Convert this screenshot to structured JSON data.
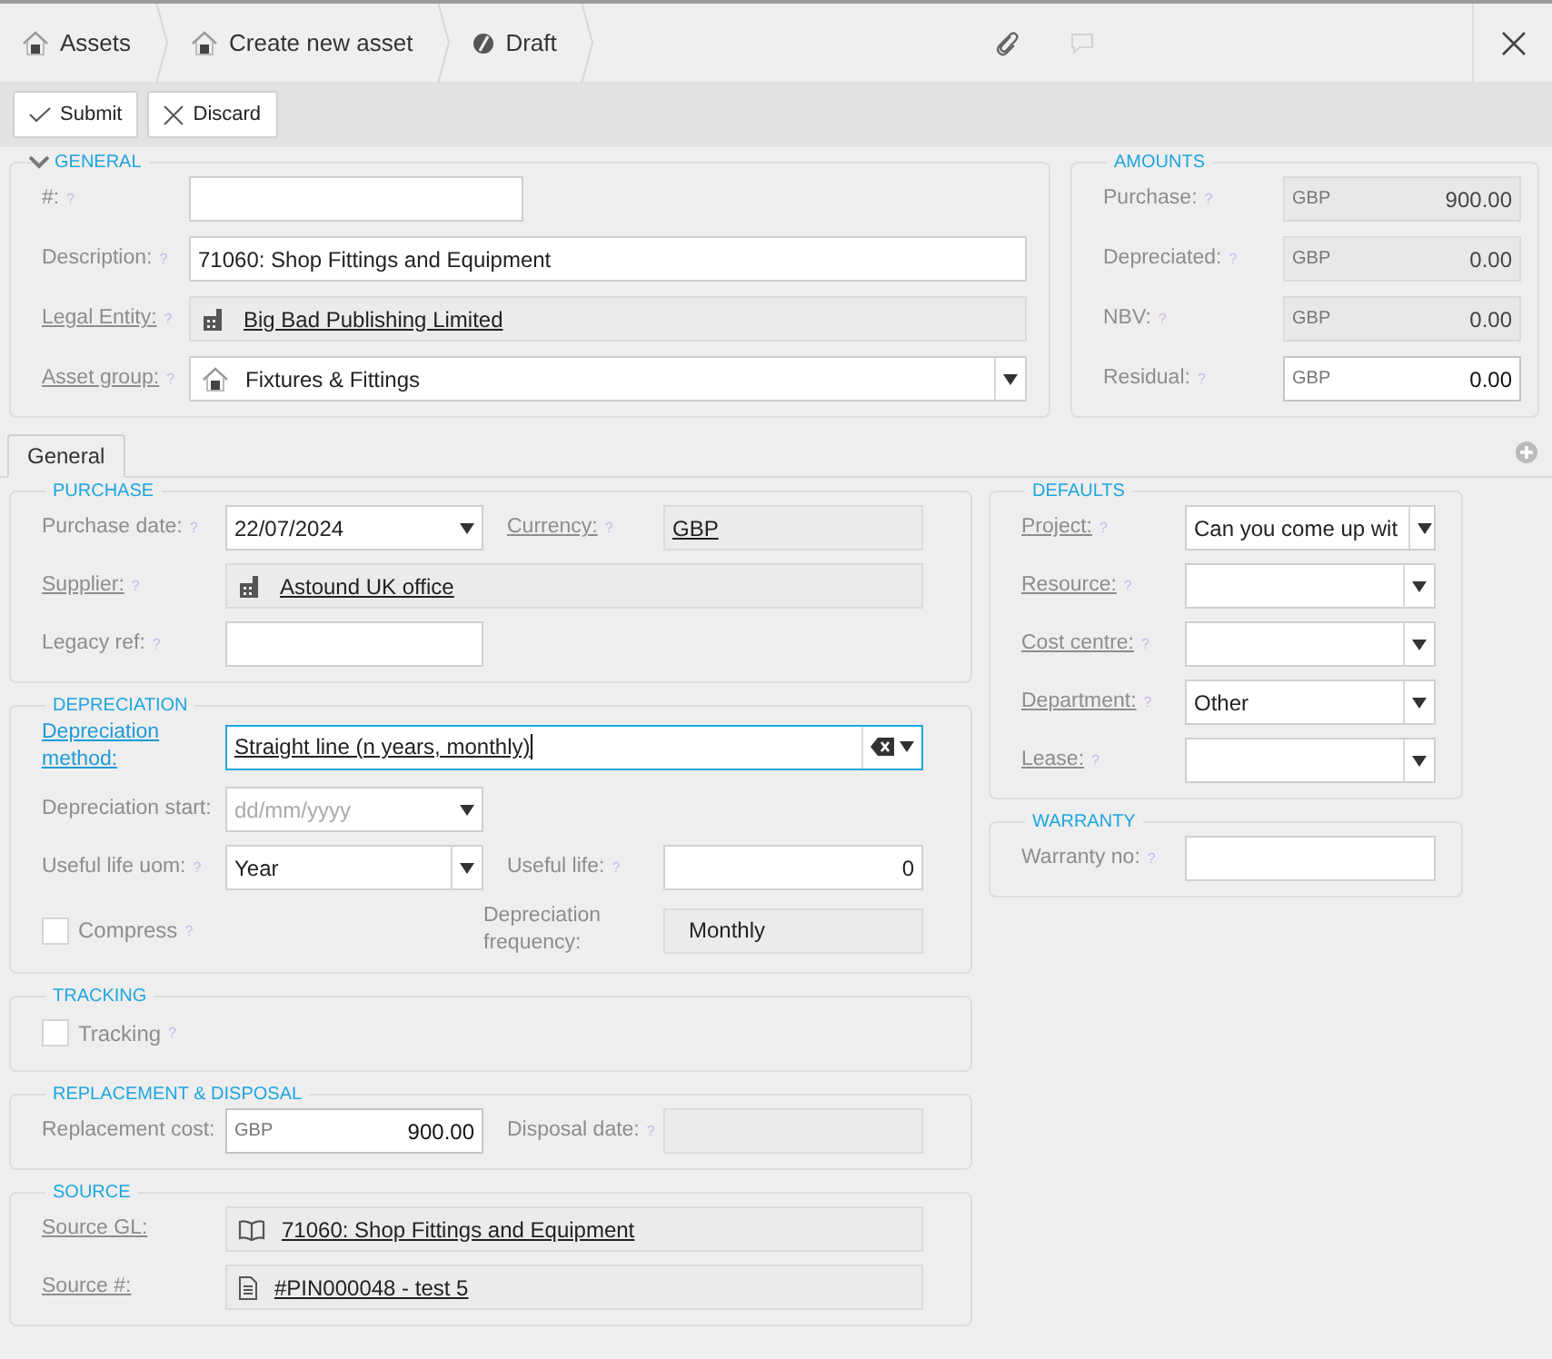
{
  "breadcrumbs": [
    {
      "kind": "module",
      "label": "Assets"
    },
    {
      "kind": "module",
      "label": "Create new asset"
    },
    {
      "kind": "status",
      "label": "Draft"
    }
  ],
  "header_actions": [
    {
      "kind": "attach",
      "disabled": false
    },
    {
      "kind": "comment",
      "disabled": true
    }
  ],
  "toolbar": [
    {
      "kind": "confirm",
      "label": "Submit"
    },
    {
      "kind": "cancel",
      "label": "Discard"
    }
  ],
  "general": {
    "title": "GENERAL",
    "expanded": true,
    "fields": [
      {
        "label": "#:",
        "label_link": false,
        "help": "?",
        "kind": "text"
      },
      {
        "label": "Description:",
        "label_link": false,
        "help": "?",
        "kind": "text",
        "value": "71060: Shop Fittings and Equipment"
      },
      {
        "label": "Legal Entity:",
        "label_link": true,
        "help": "?",
        "kind": "company",
        "value": "Big Bad Publishing Limited"
      },
      {
        "label": "Asset group:",
        "label_link": true,
        "help": "?",
        "kind": "group-select",
        "value": "Fixtures & Fittings"
      }
    ]
  },
  "amounts": {
    "title": "AMOUNTS",
    "fields": [
      {
        "label": "Purchase:",
        "label_link": false,
        "help": "?",
        "kind": "money",
        "currency": "GBP",
        "value": "900.00",
        "readonly": true
      },
      {
        "label": "Depreciated:",
        "label_link": false,
        "help": "?",
        "kind": "money",
        "currency": "GBP",
        "value": "0.00",
        "readonly": true
      },
      {
        "label": "NBV:",
        "label_link": false,
        "help": "?",
        "kind": "money",
        "currency": "GBP",
        "value": "0.00",
        "readonly": true
      },
      {
        "label": "Residual:",
        "label_link": false,
        "help": "?",
        "kind": "money",
        "currency": "GBP",
        "value": "0.00",
        "readonly": false
      }
    ]
  },
  "tabs": [
    {
      "label": "General",
      "selected": true
    }
  ],
  "left_sections": [
    {
      "title": "PURCHASE",
      "rows": [
        [
          {
            "label": "Purchase date:",
            "label_link": false,
            "help": "?",
            "kind": "date",
            "value": "22/07/2024"
          },
          {
            "label": "Currency:",
            "label_link": true,
            "help": "?",
            "kind": "readonly",
            "value": "GBP",
            "value_link": true
          }
        ],
        [
          {
            "label": "Supplier:",
            "label_link": true,
            "help": "?",
            "kind": "company",
            "value": "Astound UK office"
          }
        ],
        [
          {
            "label": "Legacy ref:",
            "label_link": false,
            "help": "?",
            "kind": "text"
          }
        ]
      ]
    },
    {
      "title": "DEPRECIATION",
      "rows": [
        [
          {
            "label": "Depreciation method:",
            "label_link": true,
            "kind": "combo",
            "value": "Straight line (n years, monthly)",
            "value_link": true,
            "focused": true
          }
        ],
        [
          {
            "label": "Depreciation start:",
            "label_link": false,
            "kind": "date",
            "placeholder": "dd/mm/yyyy"
          }
        ],
        [
          {
            "label": "Useful life uom:",
            "label_link": false,
            "help": "?",
            "kind": "select",
            "value": "Year"
          },
          {
            "label": "Useful life:",
            "label_link": false,
            "help": "?",
            "kind": "number",
            "value": "0"
          }
        ],
        [
          {
            "label": "Compress",
            "help": "?",
            "kind": "checkbox",
            "checked": false
          },
          {
            "label": "Depreciation frequency:",
            "label_link": false,
            "kind": "readonly",
            "value": "Monthly",
            "value_link": false
          }
        ]
      ]
    },
    {
      "title": "TRACKING",
      "rows": [
        [
          {
            "label": "Tracking",
            "help": "?",
            "kind": "checkbox",
            "checked": false
          }
        ]
      ]
    },
    {
      "title": "REPLACEMENT & DISPOSAL",
      "rows": [
        [
          {
            "label": "Replacement cost:",
            "label_link": false,
            "kind": "money",
            "currency": "GBP",
            "value": "900.00",
            "readonly": false
          },
          {
            "label": "Disposal date:",
            "label_link": false,
            "help": "?",
            "kind": "readonly"
          }
        ]
      ]
    },
    {
      "title": "SOURCE",
      "rows": [
        [
          {
            "label": "Source GL:",
            "label_link": true,
            "kind": "account",
            "value": "71060: Shop Fittings and Equipment"
          }
        ],
        [
          {
            "label": "Source #:",
            "label_link": true,
            "kind": "document",
            "value": "#PIN000048 - test 5"
          }
        ]
      ]
    }
  ],
  "right_sections": [
    {
      "title": "DEFAULTS",
      "rows": [
        [
          {
            "label": "Project:",
            "label_link": true,
            "help": "?",
            "kind": "select",
            "value": "Can you come up wit"
          }
        ],
        [
          {
            "label": "Resource:",
            "label_link": true,
            "help": "?",
            "kind": "select"
          }
        ],
        [
          {
            "label": "Cost centre:",
            "label_link": true,
            "help": "?",
            "kind": "select"
          }
        ],
        [
          {
            "label": "Department:",
            "label_link": true,
            "help": "?",
            "kind": "select",
            "value": "Other"
          }
        ],
        [
          {
            "label": "Lease:",
            "label_link": true,
            "help": "?",
            "kind": "select"
          }
        ]
      ]
    },
    {
      "title": "WARRANTY",
      "rows": [
        [
          {
            "label": "Warranty no:",
            "label_link": false,
            "help": "?",
            "kind": "text"
          }
        ]
      ]
    }
  ]
}
